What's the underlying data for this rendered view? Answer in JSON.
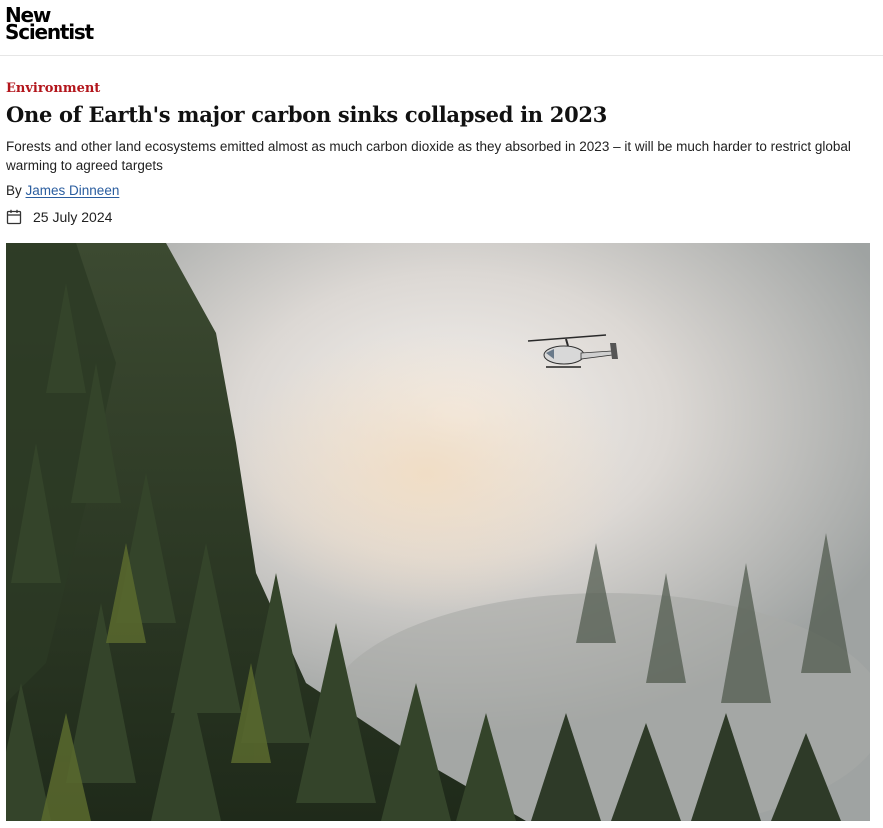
{
  "masthead": {
    "logo_line1": "New",
    "logo_line2": "Scientist",
    "logo_icon": "new-scientist-logo"
  },
  "article": {
    "section": "Environment",
    "headline": "One of Earth's major carbon sinks collapsed in 2023",
    "standfirst": "Forests and other land ecosystems emitted almost as much carbon dioxide as they absorbed in 2023 – it will be much harder to restrict global warming to agreed targets",
    "byline_prefix": "By",
    "author": "James Dinneen",
    "date": "25 July 2024",
    "date_icon": "calendar-icon"
  },
  "hero_image": {
    "subject": "forest-fire-smoke-helicopter"
  },
  "colors": {
    "section": "#b3161c",
    "author_link": "#2a5d9f",
    "divider": "#e6e6e6"
  }
}
